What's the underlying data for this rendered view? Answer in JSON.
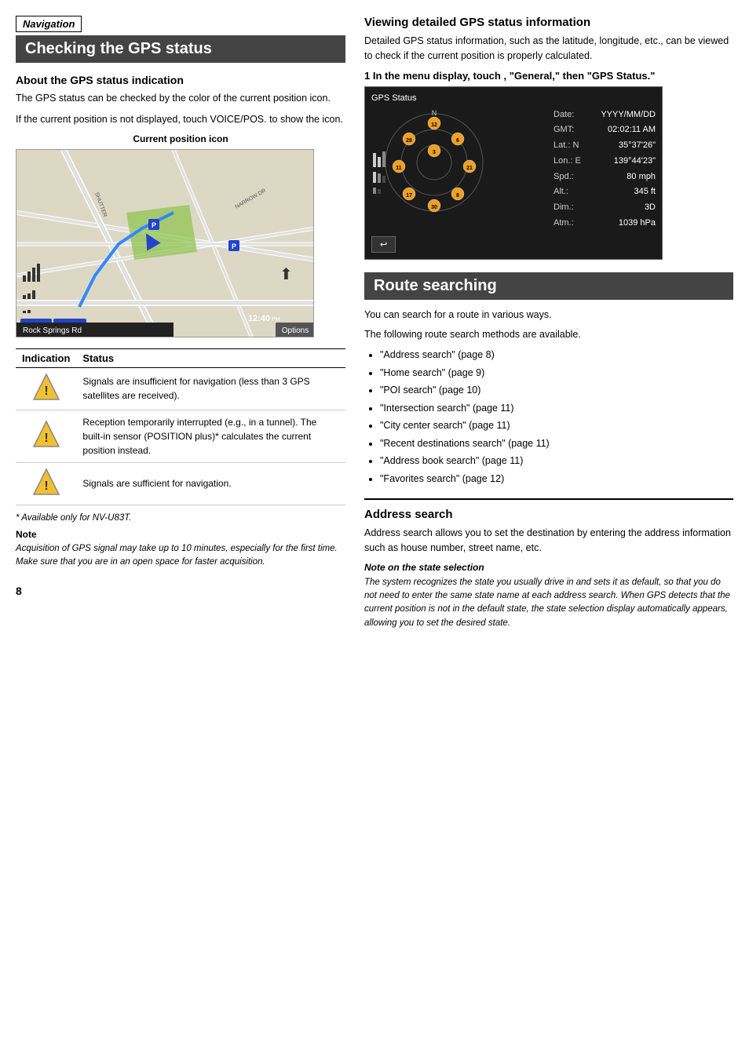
{
  "nav_label": "Navigation",
  "page_title": "Checking the GPS status",
  "about_gps": {
    "title": "About the GPS status indication",
    "para1": "The GPS status can be checked by the color of the current position icon.",
    "para2": "If the current position is not displayed, touch VOICE/POS. to show the icon.",
    "map_label": "Current position icon"
  },
  "table": {
    "col1": "Indication",
    "col2": "Status",
    "rows": [
      {
        "icon": "warning",
        "status": "Signals are insufficient for navigation (less than 3 GPS satellites are received)."
      },
      {
        "icon": "warning",
        "status": "Reception temporarily interrupted (e.g., in a tunnel). The built-in sensor (POSITION plus)* calculates the current position instead."
      },
      {
        "icon": "warning",
        "status": "Signals are sufficient for navigation."
      }
    ]
  },
  "footnote": "* Available only for NV-U83T.",
  "note": {
    "label": "Note",
    "text": "Acquisition of GPS signal may take up to 10 minutes, especially for the first time. Make sure that you are in an open space for faster acquisition."
  },
  "right": {
    "viewing_title": "Viewing detailed GPS status information",
    "viewing_body": "Detailed GPS status information, such as the latitude, longitude, etc., can be viewed to check if the current position is properly calculated.",
    "step1": "In the menu display, touch       , \"General,\" then \"GPS Status.\"",
    "gps_status": {
      "header": "GPS Status",
      "date_label": "Date:",
      "date_val": "YYYY/MM/DD",
      "gmt_label": "GMT:",
      "gmt_val": "02:02:11 AM",
      "lat_label": "Lat.: N",
      "lat_val": "35°37'26\"",
      "lon_label": "Lon.: E",
      "lon_val": "139°44'23\"",
      "spd_label": "Spd.:",
      "spd_val": "80 mph",
      "alt_label": "Alt.:",
      "alt_val": "345 ft",
      "dim_label": "Dim.:",
      "dim_val": "3D",
      "atm_label": "Atm.:",
      "atm_val": "1039 hPa",
      "back_btn": "↩"
    },
    "route_title": "Route searching",
    "route_body1": "You can search for a route in various ways.",
    "route_body2": "The following route search methods are available.",
    "route_list": [
      "\"Address search\" (page 8)",
      "\"Home search\" (page 9)",
      "\"POI search\" (page 10)",
      "\"Intersection search\" (page 11)",
      "\"City center search\" (page 11)",
      "\"Recent destinations search\" (page 11)",
      "\"Address book search\" (page 11)",
      "\"Favorites search\" (page 12)"
    ],
    "address_title": "Address search",
    "address_body": "Address search allows you to set the destination by entering the address information such as house number, street name, etc.",
    "note_state_label": "Note on the state selection",
    "note_state_text": "The system recognizes the state you usually drive in and sets it as default, so that you do not need to enter the same state name at each address search. When GPS detects that the current position is not in the default state, the state selection display automatically appears, allowing you to set the desired state."
  },
  "page_number": "8"
}
